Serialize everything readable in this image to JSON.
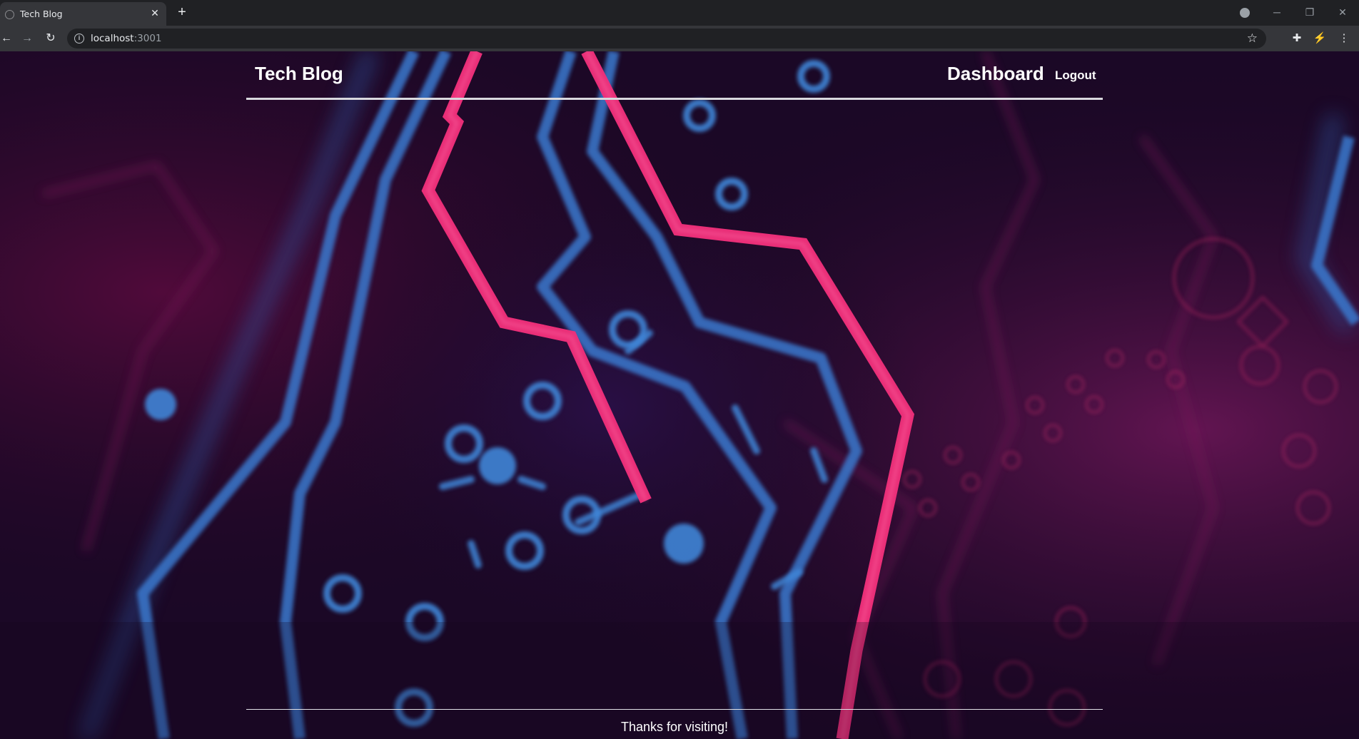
{
  "browser": {
    "tab_title": "Tech Blog",
    "tab_close": "✕",
    "new_tab": "+",
    "url_host": "localhost",
    "url_port": ":3001",
    "info_icon": "i",
    "window_controls": {
      "minimize": "─",
      "restore": "❐",
      "close": "✕"
    }
  },
  "site": {
    "title": "Tech Blog",
    "nav": {
      "dashboard": "Dashboard",
      "logout": "Logout"
    },
    "footer_text": "Thanks for visiting!"
  },
  "colors": {
    "background": "#1a0824",
    "trace_pink": "#f0307a",
    "trace_blue": "#3f86d8",
    "text": "#ffffff"
  }
}
